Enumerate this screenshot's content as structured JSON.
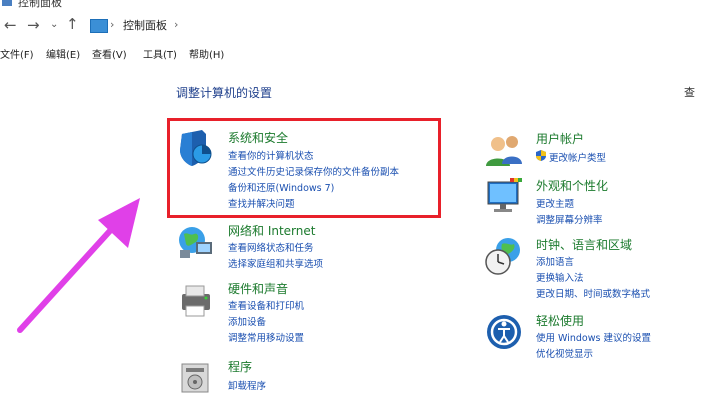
{
  "window": {
    "title": "控制面板"
  },
  "address": {
    "path": "控制面板"
  },
  "menu": [
    "文件(F)",
    "编辑(E)",
    "查看(V)",
    "工具(T)",
    "帮助(H)"
  ],
  "page": {
    "title": "调整计算机的设置",
    "view_label": "查"
  },
  "categories": {
    "system": {
      "title": "系统和安全",
      "links": [
        "查看你的计算机状态",
        "通过文件历史记录保存你的文件备份副本",
        "备份和还原(Windows 7)",
        "查找并解决问题"
      ]
    },
    "network": {
      "title": "网络和 Internet",
      "links": [
        "查看网络状态和任务",
        "选择家庭组和共享选项"
      ]
    },
    "hardware": {
      "title": "硬件和声音",
      "links": [
        "查看设备和打印机",
        "添加设备",
        "调整常用移动设置"
      ]
    },
    "programs": {
      "title": "程序",
      "links": [
        "卸载程序"
      ]
    },
    "users": {
      "title": "用户帐户",
      "links": [
        "更改帐户类型"
      ]
    },
    "appearance": {
      "title": "外观和个性化",
      "links": [
        "更改主题",
        "调整屏幕分辨率"
      ]
    },
    "clock": {
      "title": "时钟、语言和区域",
      "links": [
        "添加语言",
        "更换输入法",
        "更改日期、时间或数字格式"
      ]
    },
    "ease": {
      "title": "轻松使用",
      "links": [
        "使用 Windows 建议的设置",
        "优化视觉显示"
      ]
    }
  },
  "colors": {
    "highlight": "#e8202a",
    "arrow": "#e040e8",
    "title_green": "#1b7a2d",
    "link_blue": "#1a4fb0"
  }
}
